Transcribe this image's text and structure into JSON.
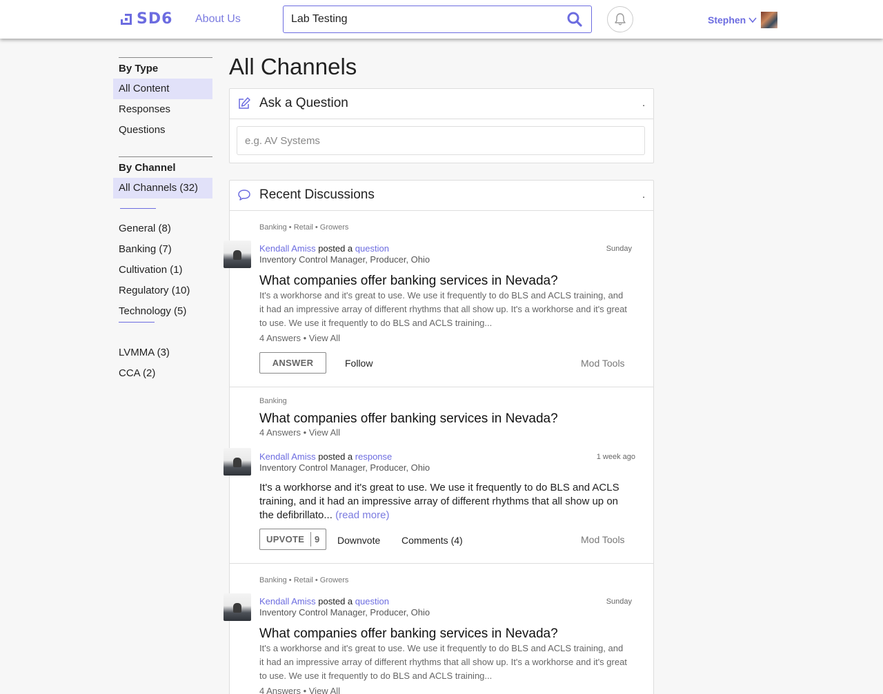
{
  "header": {
    "logo_text": "SD6",
    "about_label": "About Us",
    "search_value": "Lab Testing",
    "user_name": "Stephen",
    "brand_color": "#6c6ce0"
  },
  "sidebar": {
    "by_type_heading": "By Type",
    "type_items": [
      "All Content",
      "Responses",
      "Questions"
    ],
    "by_channel_heading": "By Channel",
    "channel_all": "All Channels (32)",
    "channel_items": [
      "General (8)",
      "Banking (7)",
      "Cultivation (1)",
      "Regulatory (10)",
      "Technology (5)"
    ],
    "extra_items": [
      "LVMMA (3)",
      "CCA (2)"
    ]
  },
  "main": {
    "page_title": "All Channels",
    "ask": {
      "title": "Ask a Question",
      "dot": ".",
      "placeholder": "e.g. AV Systems"
    },
    "discussions": {
      "title": "Recent Discussions",
      "dot": "."
    }
  },
  "posts": [
    {
      "tags": "Banking • Retail • Growers",
      "author": "Kendall Amiss",
      "posted_a": "posted a",
      "kind": "question",
      "role": "Inventory Control Manager, Producer, Ohio",
      "when": "Sunday",
      "title": "What companies offer banking services in Nevada?",
      "excerpt": "It's a workhorse and it's great to use. We use it frequently to do BLS and ACLS training, and it had an impressive array of different rhythms that all show up. It's a workhorse and it's great to use. We use it frequently to do BLS and ACLS training...",
      "meta": "4 Answers • View All",
      "answer_label": "ANSWER",
      "follow_label": "Follow",
      "mod_label": "Mod Tools"
    },
    {
      "tags": "Banking",
      "title": "What companies offer banking services in Nevada?",
      "meta": "4 Answers • View All",
      "author": "Kendall Amiss",
      "posted_a": "posted a",
      "kind": "response",
      "role": "Inventory Control Manager, Producer, Ohio",
      "when": "1 week ago",
      "body": "It's a workhorse and it's great to use. We use it frequently to do BLS and ACLS training, and it had an impressive array of different rhythms that all show up on the defibrillato...",
      "read_more": "(read more)",
      "upvote_label": "UPVOTE",
      "upvote_count": "9",
      "downvote_label": "Downvote",
      "comments_label": "Comments (4)",
      "mod_label": "Mod Tools"
    },
    {
      "tags": "Banking • Retail • Growers",
      "author": "Kendall Amiss",
      "posted_a": "posted a",
      "kind": "question",
      "role": "Inventory Control Manager, Producer, Ohio",
      "when": "Sunday",
      "title": "What companies offer banking services in Nevada?",
      "excerpt": "It's a workhorse and it's great to use. We use it frequently to do BLS and ACLS training, and it had an impressive array of different rhythms that all show up. It's a workhorse and it's great to use. We use it frequently to do BLS and ACLS training...",
      "meta": "4 Answers • View All"
    }
  ]
}
